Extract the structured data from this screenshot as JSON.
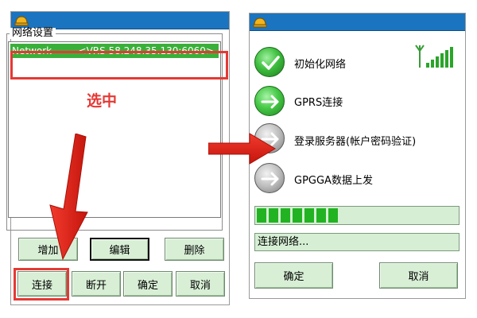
{
  "left_window": {
    "group_title": "网络设置",
    "network_row": {
      "name": "Network",
      "value": "<VRS  58.248.35.130:6060>"
    },
    "annotation": "选中",
    "buttons": {
      "add": "增加",
      "edit": "编辑",
      "delete": "删除",
      "connect": "连接",
      "disconnect": "断开",
      "ok": "确定",
      "cancel": "取消"
    }
  },
  "right_window": {
    "steps": [
      {
        "label": "初始化网络",
        "state": "done"
      },
      {
        "label": "GPRS连接",
        "state": "active"
      },
      {
        "label": "登录服务器(帐户密码验证)",
        "state": "pending"
      },
      {
        "label": "GPGGA数据上发",
        "state": "pending"
      }
    ],
    "progress": {
      "filled_segments": 7,
      "total_segments": 17
    },
    "status_text": "连接网络...",
    "buttons": {
      "ok": "确定",
      "cancel": "取消"
    }
  },
  "colors": {
    "titlebar": "#1b74bf",
    "selection": "#3ab03a",
    "button_bg": "#d8efd6",
    "annotation_red": "#e53935",
    "progress_green": "#22b322"
  }
}
